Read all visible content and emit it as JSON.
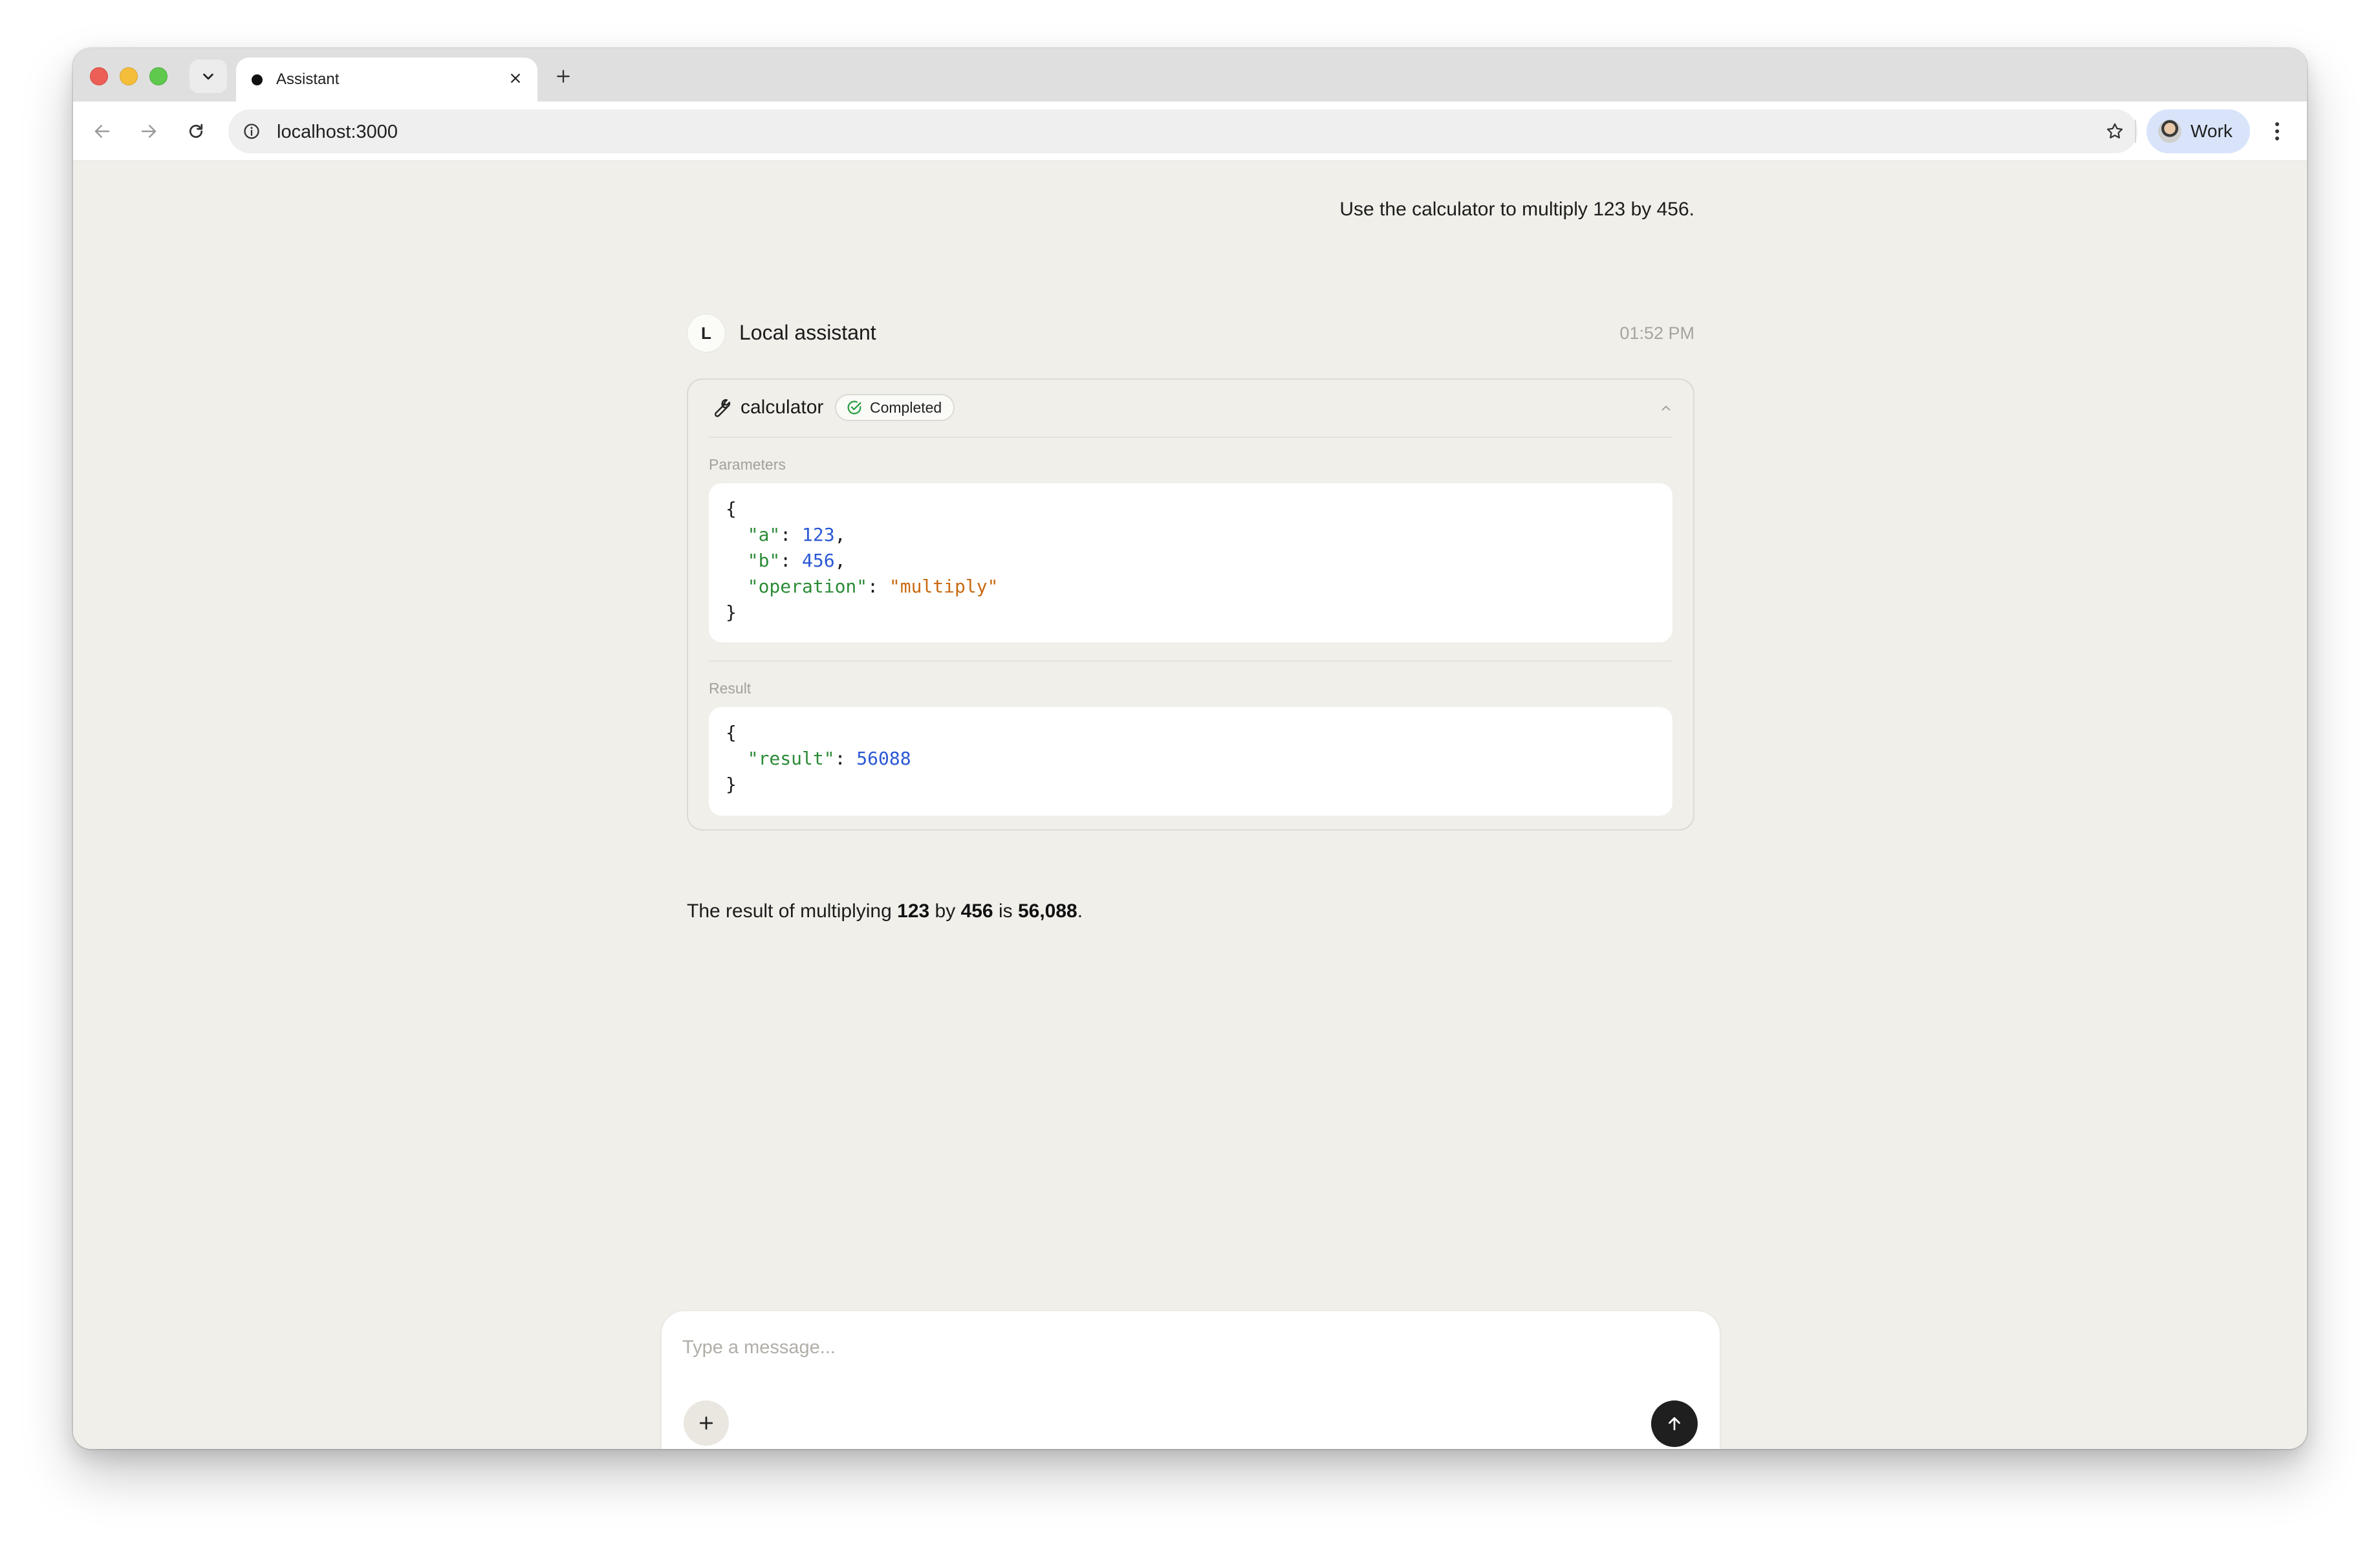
{
  "browser": {
    "tab_title": "Assistant",
    "url": "localhost:3000",
    "profile_label": "Work",
    "icons": {
      "tab_search": "chevron-down-icon",
      "tab_close": "close-icon",
      "new_tab": "plus-icon",
      "back": "arrow-left-icon",
      "forward": "arrow-right-icon",
      "reload": "reload-icon",
      "site_info": "info-icon",
      "bookmark": "star-icon",
      "extensions": "puzzle-icon",
      "menu": "kebab-menu-icon"
    }
  },
  "chat": {
    "user_message": "Use the calculator to multiply 123 by 456.",
    "assistant": {
      "avatar_letter": "L",
      "name": "Local assistant",
      "time": "01:52 PM"
    },
    "tool_call": {
      "name": "calculator",
      "status": "Completed",
      "parameters_label": "Parameters",
      "result_label": "Result",
      "parameters": {
        "open": "{",
        "lines": [
          {
            "key": "\"a\"",
            "value": "123",
            "value_type": "number",
            "trail": ","
          },
          {
            "key": "\"b\"",
            "value": "456",
            "value_type": "number",
            "trail": ","
          },
          {
            "key": "\"operation\"",
            "value": "\"multiply\"",
            "value_type": "string",
            "trail": ""
          }
        ],
        "close": "}"
      },
      "result": {
        "open": "{",
        "lines": [
          {
            "key": "\"result\"",
            "value": "56088",
            "value_type": "number",
            "trail": ""
          }
        ],
        "close": "}"
      }
    },
    "final_answer": {
      "prefix": "The result of multiplying ",
      "a": "123",
      "middle": " by ",
      "b": "456",
      "is": " is ",
      "result": "56,088",
      "suffix": "."
    }
  },
  "composer": {
    "placeholder": "Type a message...",
    "icons": {
      "attach": "plus-icon",
      "send": "arrow-up-icon"
    }
  },
  "colors": {
    "page_bg": "#f0efea",
    "json_key": "#2c8b38",
    "json_number": "#2958d4",
    "json_string": "#c96a12",
    "status_ok": "#2ea043",
    "send_button": "#1f1f1f"
  }
}
